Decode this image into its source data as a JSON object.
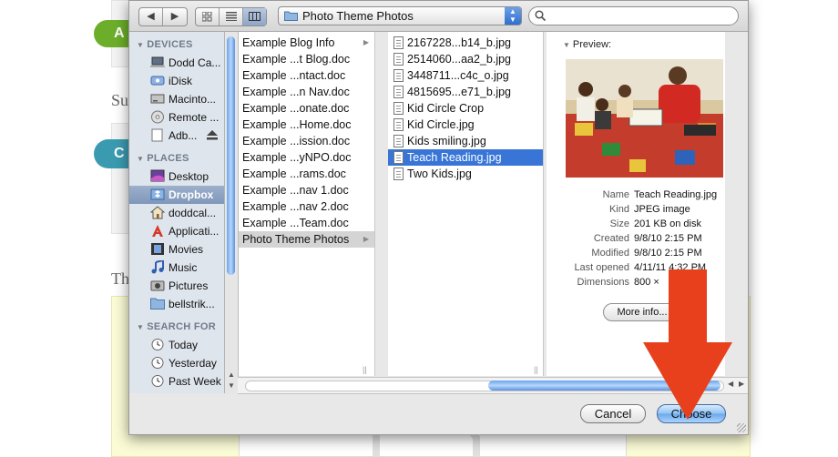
{
  "background": {
    "green_button_text": "A",
    "teal_button_text": "C",
    "text_1": "Su",
    "text_2": "Th"
  },
  "toolbar": {
    "back_icon": "back-arrow-icon",
    "forward_icon": "forward-arrow-icon",
    "view_modes": [
      "icon-view-icon",
      "list-view-icon",
      "column-view-icon"
    ],
    "active_view": "column-view-icon",
    "path_popup": "Photo Theme Photos",
    "search_value": "",
    "search_placeholder": ""
  },
  "sidebar": {
    "sections": [
      {
        "title": "DEVICES",
        "items": [
          {
            "label": "Dodd Ca...",
            "icon": "laptop-icon"
          },
          {
            "label": "iDisk",
            "icon": "idisk-icon"
          },
          {
            "label": "Macinto...",
            "icon": "hard-drive-icon"
          },
          {
            "label": "Remote ...",
            "icon": "disc-icon"
          },
          {
            "label": "Adb...",
            "icon": "disk-image-icon"
          }
        ]
      },
      {
        "title": "PLACES",
        "items": [
          {
            "label": "Desktop",
            "icon": "desktop-icon"
          },
          {
            "label": "Dropbox",
            "icon": "dropbox-icon",
            "selected": true
          },
          {
            "label": "doddcal...",
            "icon": "home-icon"
          },
          {
            "label": "Applicati...",
            "icon": "applications-icon"
          },
          {
            "label": "Movies",
            "icon": "movies-icon"
          },
          {
            "label": "Music",
            "icon": "music-icon"
          },
          {
            "label": "Pictures",
            "icon": "pictures-icon"
          },
          {
            "label": "bellstrik...",
            "icon": "folder-icon"
          }
        ]
      },
      {
        "title": "SEARCH FOR",
        "items": [
          {
            "label": "Today",
            "icon": "clock-icon"
          },
          {
            "label": "Yesterday",
            "icon": "clock-icon"
          },
          {
            "label": "Past Week",
            "icon": "clock-icon"
          }
        ]
      }
    ]
  },
  "column1": {
    "items": [
      {
        "label": "Example Blog Info",
        "folder": true
      },
      {
        "label": "Example ...t Blog.doc"
      },
      {
        "label": "Example ...ntact.doc"
      },
      {
        "label": "Example ...n Nav.doc"
      },
      {
        "label": "Example ...onate.doc"
      },
      {
        "label": "Example ...Home.doc"
      },
      {
        "label": "Example ...ission.doc"
      },
      {
        "label": "Example ...yNPO.doc"
      },
      {
        "label": "Example ...rams.doc"
      },
      {
        "label": "Example ...nav 1.doc"
      },
      {
        "label": "Example ...nav 2.doc"
      },
      {
        "label": "Example ...Team.doc"
      },
      {
        "label": "Photo Theme Photos",
        "folder": true,
        "selected": true
      }
    ]
  },
  "column2": {
    "items": [
      {
        "label": "2167228...b14_b.jpg"
      },
      {
        "label": "2514060...aa2_b.jpg"
      },
      {
        "label": "3448711...c4c_o.jpg"
      },
      {
        "label": "4815695...e71_b.jpg"
      },
      {
        "label": "Kid Circle Crop"
      },
      {
        "label": "Kid Circle.jpg"
      },
      {
        "label": "Kids smiling.jpg"
      },
      {
        "label": "Teach Reading.jpg",
        "selected": true
      },
      {
        "label": "Two Kids.jpg"
      }
    ]
  },
  "preview": {
    "title": "Preview:",
    "fields": [
      {
        "key": "Name",
        "value": "Teach Reading.jpg"
      },
      {
        "key": "Kind",
        "value": "JPEG image"
      },
      {
        "key": "Size",
        "value": "201 KB on disk"
      },
      {
        "key": "Created",
        "value": "9/8/10 2:15 PM"
      },
      {
        "key": "Modified",
        "value": "9/8/10 2:15 PM"
      },
      {
        "key": "Last opened",
        "value": "4/11/11 4:32 PM"
      },
      {
        "key": "Dimensions",
        "value": "800 ×"
      }
    ],
    "more_info": "More info..."
  },
  "footer": {
    "cancel": "Cancel",
    "choose": "Choose"
  },
  "colors": {
    "selection_blue": "#3875d7",
    "annotation_arrow": "#e8401c"
  }
}
